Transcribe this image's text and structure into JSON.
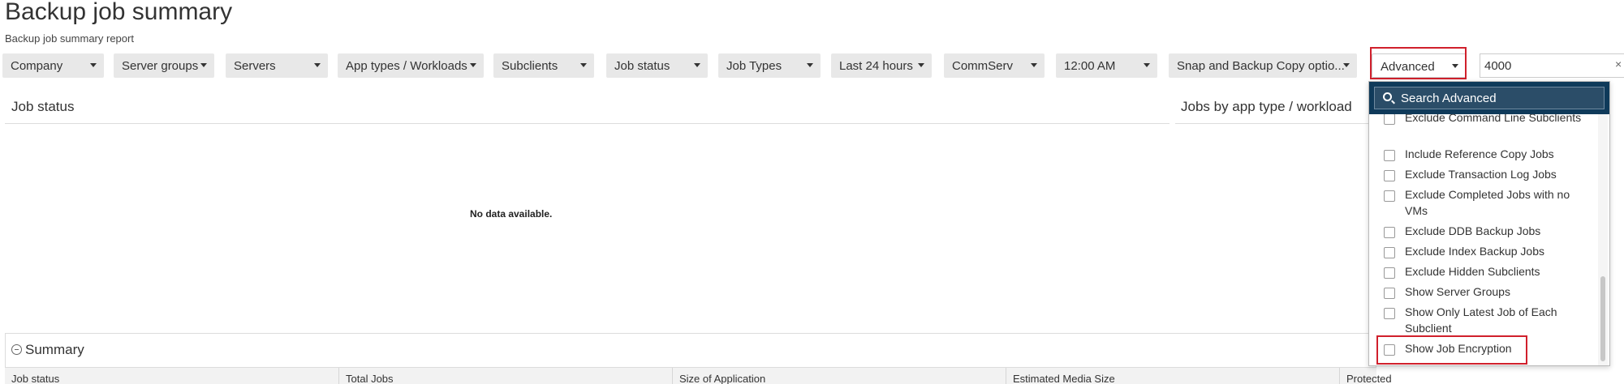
{
  "page": {
    "title": "Backup job summary",
    "subtitle": "Backup job summary report"
  },
  "filters": [
    {
      "label": "Company"
    },
    {
      "label": "Server groups"
    },
    {
      "label": "Servers"
    },
    {
      "label": "App types / Workloads"
    },
    {
      "label": "Subclients"
    },
    {
      "label": "Job status"
    },
    {
      "label": "Job Types"
    },
    {
      "label": "Last 24 hours"
    },
    {
      "label": "CommServ"
    },
    {
      "label": "12:00 AM"
    },
    {
      "label": "Snap and Backup Copy optio..."
    },
    {
      "label": "Advanced"
    }
  ],
  "search_box": {
    "value": "4000",
    "clear": "×"
  },
  "sections": {
    "job_status": "Job status",
    "jobs_by_app": "Jobs by app type / workload",
    "no_data": "No data available."
  },
  "summary": {
    "title": "Summary",
    "columns": [
      "Job status",
      "Total Jobs",
      "Size of Application",
      "Estimated Media Size",
      "Protected Objects"
    ]
  },
  "dropdown": {
    "search_placeholder": "Search Advanced",
    "items": [
      {
        "label": "Exclude Command Line Subclients",
        "checked": false
      },
      {
        "label": "Include Reference Copy Jobs",
        "checked": false
      },
      {
        "label": "Exclude Transaction Log Jobs",
        "checked": false
      },
      {
        "label": "Exclude Completed Jobs with no VMs",
        "checked": false
      },
      {
        "label": "Exclude DDB Backup Jobs",
        "checked": false
      },
      {
        "label": "Exclude Index Backup Jobs",
        "checked": false
      },
      {
        "label": "Exclude Hidden Subclients",
        "checked": false
      },
      {
        "label": "Show Server Groups",
        "checked": false
      },
      {
        "label": "Show Only Latest Job of Each Subclient",
        "checked": false
      },
      {
        "label": "Show Job Encryption",
        "checked": false
      }
    ]
  },
  "colors": {
    "highlight": "#d0202c",
    "dropdown_header": "#0f3a5a",
    "filter_bg": "#e8e8e8"
  }
}
